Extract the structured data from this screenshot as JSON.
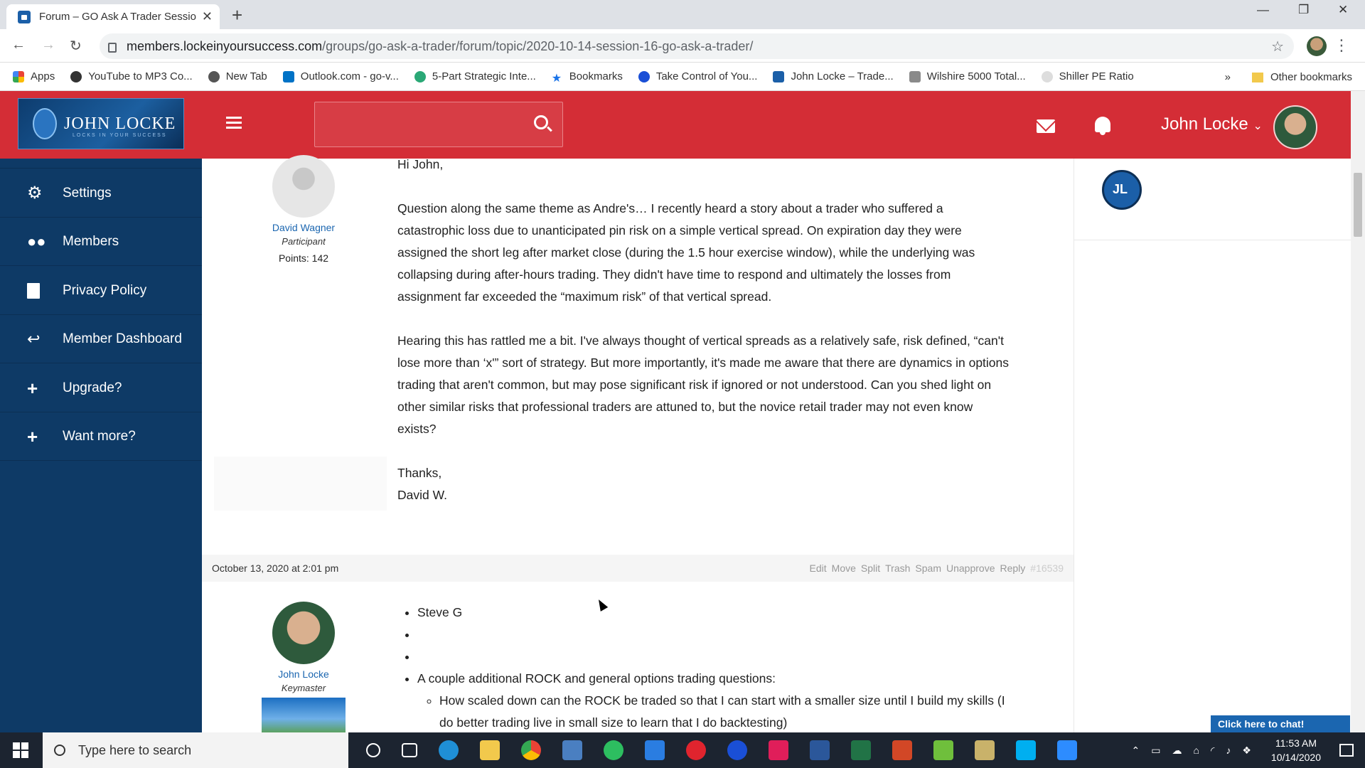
{
  "browser": {
    "tab_title": "Forum – GO Ask A Trader Sessior",
    "url_host": "members.lockeinyoursuccess.com",
    "url_path": "/groups/go-ask-a-trader/forum/topic/2020-10-14-session-16-go-ask-a-trader/",
    "bookmarks": [
      "Apps",
      "YouTube to MP3 Co...",
      "New Tab",
      "Outlook.com - go-v...",
      "5-Part Strategic Inte...",
      "Bookmarks",
      "Take Control of You...",
      "John Locke – Trade...",
      "Wilshire 5000 Total...",
      "Shiller PE Ratio"
    ],
    "bookmarks_more": "»",
    "other_bookmarks": "Other bookmarks"
  },
  "header": {
    "logo_text": "JOHN LOCKE",
    "logo_tagline": "LOCKS IN YOUR SUCCESS",
    "user_name": "John Locke"
  },
  "sidebar": {
    "items": [
      {
        "label": "Settings",
        "icon": "gears-icon"
      },
      {
        "label": "Members",
        "icon": "users-icon"
      },
      {
        "label": "Privacy Policy",
        "icon": "document-icon"
      },
      {
        "label": "Member Dashboard",
        "icon": "reply-all-icon"
      },
      {
        "label": "Upgrade?",
        "icon": "plus-icon"
      },
      {
        "label": "Want more?",
        "icon": "plus-icon"
      }
    ]
  },
  "post1": {
    "author": "David Wagner",
    "role": "Participant",
    "points": "Points: 142",
    "greeting": "Hi John,",
    "p1": "Question along the same theme as Andre's… I recently heard a story about a trader who suffered a catastrophic loss due to unanticipated pin risk on a simple vertical spread. On expiration day they were assigned the short leg after market close (during the 1.5 hour exercise window), while the underlying was collapsing during after-hours trading. They didn't have time to respond and ultimately the losses from assignment far exceeded the “maximum risk” of that vertical spread.",
    "p2": "Hearing this has rattled me a bit. I've always thought of vertical spreads as a relatively safe, risk defined, “can't lose more than ‘x'” sort of strategy. But more importantly, it's made me aware that there are dynamics in options trading that aren't common, but may pose significant risk if ignored or not understood. Can you shed light on other similar risks that professional traders are attuned to, but the novice retail trader may not even know exists?",
    "sign1": "Thanks,",
    "sign2": "David W."
  },
  "post2": {
    "date": "October 13, 2020 at 2:01 pm",
    "actions": [
      "Edit",
      "Move",
      "Split",
      "Trash",
      "Spam",
      "Unapprove",
      "Reply"
    ],
    "post_id": "#16539",
    "author": "John Locke",
    "role": "Keymaster",
    "items": [
      "Steve G",
      "",
      "",
      "A couple additional ROCK and general options trading questions:"
    ],
    "subitems": [
      "How scaled down can the ROCK be traded so that I can start with a smaller size until I build my skills (I do better trading live in small size to learn that I do backtesting)"
    ]
  },
  "chat": {
    "label": "Click here to chat!"
  },
  "taskbar": {
    "search_placeholder": "Type here to search",
    "time": "11:53 AM",
    "date": "10/14/2020"
  },
  "colors": {
    "header": "#d42d36",
    "sidebar": "#0e3a66",
    "link": "#1b66b0"
  }
}
